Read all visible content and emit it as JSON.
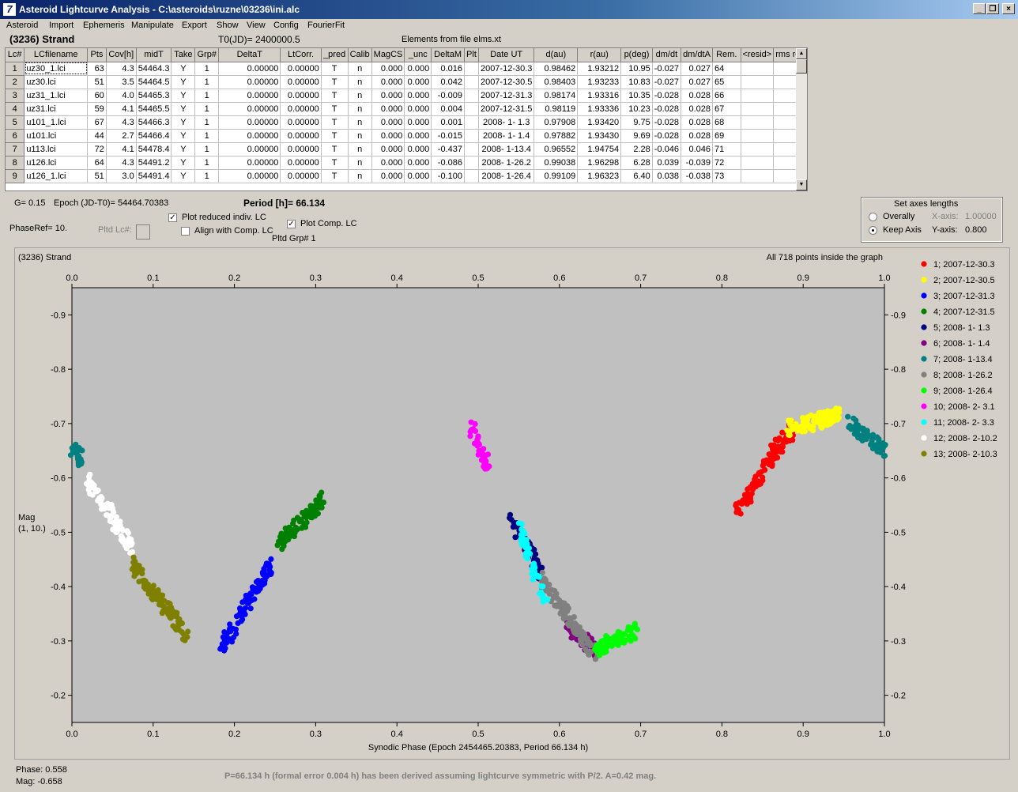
{
  "window": {
    "title": "Asteroid Lightcurve Analysis - C:\\asteroids\\ruzne\\03236\\ini.alc",
    "icon": "7"
  },
  "menu": [
    "Asteroid",
    "Import",
    "Ephemeris",
    "Manipulate",
    "Export",
    "Show",
    "View",
    "Config",
    "FourierFit"
  ],
  "header": {
    "asteroid": "(3236) Strand",
    "t0": "T0(JD)= 2400000.5",
    "elements": "Elements from file elms.xt"
  },
  "table": {
    "columns": [
      "Lc#",
      "LCfilename",
      "Pts",
      "Cov[h]",
      "midT",
      "Take",
      "Grp#",
      "DeltaT",
      "LtCorr.",
      "_pred",
      "Calib",
      "MagCS",
      "_unc",
      "DeltaM",
      "Plt",
      "Date UT",
      "d(au)",
      "r(au)",
      "p(deg)",
      "dm/dt",
      "dm/dtA",
      "Rem.",
      "<resid>",
      "rms res"
    ],
    "rows": [
      [
        "1",
        "uz30_1.lci",
        "63",
        "4.3",
        "54464.3",
        "Y",
        "1",
        "0.00000",
        "0.00000",
        "T",
        "n",
        "0.000",
        "0.000",
        "0.016",
        "",
        "2007-12-30.3",
        "0.98462",
        "1.93212",
        "10.95",
        "-0.027",
        "0.027",
        "64",
        "",
        ""
      ],
      [
        "2",
        "uz30.lci",
        "51",
        "3.5",
        "54464.5",
        "Y",
        "1",
        "0.00000",
        "0.00000",
        "T",
        "n",
        "0.000",
        "0.000",
        "0.042",
        "",
        "2007-12-30.5",
        "0.98403",
        "1.93233",
        "10.83",
        "-0.027",
        "0.027",
        "65",
        "",
        ""
      ],
      [
        "3",
        "uz31_1.lci",
        "60",
        "4.0",
        "54465.3",
        "Y",
        "1",
        "0.00000",
        "0.00000",
        "T",
        "n",
        "0.000",
        "0.000",
        "-0.009",
        "",
        "2007-12-31.3",
        "0.98174",
        "1.93316",
        "10.35",
        "-0.028",
        "0.028",
        "66",
        "",
        ""
      ],
      [
        "4",
        "uz31.lci",
        "59",
        "4.1",
        "54465.5",
        "Y",
        "1",
        "0.00000",
        "0.00000",
        "T",
        "n",
        "0.000",
        "0.000",
        "0.004",
        "",
        "2007-12-31.5",
        "0.98119",
        "1.93336",
        "10.23",
        "-0.028",
        "0.028",
        "67",
        "",
        ""
      ],
      [
        "5",
        "u101_1.lci",
        "67",
        "4.3",
        "54466.3",
        "Y",
        "1",
        "0.00000",
        "0.00000",
        "T",
        "n",
        "0.000",
        "0.000",
        "0.001",
        "",
        "2008- 1- 1.3",
        "0.97908",
        "1.93420",
        "9.75",
        "-0.028",
        "0.028",
        "68",
        "",
        ""
      ],
      [
        "6",
        "u101.lci",
        "44",
        "2.7",
        "54466.4",
        "Y",
        "1",
        "0.00000",
        "0.00000",
        "T",
        "n",
        "0.000",
        "0.000",
        "-0.015",
        "",
        "2008- 1- 1.4",
        "0.97882",
        "1.93430",
        "9.69",
        "-0.028",
        "0.028",
        "69",
        "",
        ""
      ],
      [
        "7",
        "u113.lci",
        "72",
        "4.1",
        "54478.4",
        "Y",
        "1",
        "0.00000",
        "0.00000",
        "T",
        "n",
        "0.000",
        "0.000",
        "-0.437",
        "",
        "2008- 1-13.4",
        "0.96552",
        "1.94754",
        "2.28",
        "-0.046",
        "0.046",
        "71",
        "",
        ""
      ],
      [
        "8",
        "u126.lci",
        "64",
        "4.3",
        "54491.2",
        "Y",
        "1",
        "0.00000",
        "0.00000",
        "T",
        "n",
        "0.000",
        "0.000",
        "-0.086",
        "",
        "2008- 1-26.2",
        "0.99038",
        "1.96298",
        "6.28",
        "0.039",
        "-0.039",
        "72",
        "",
        ""
      ],
      [
        "9",
        "u126_1.lci",
        "51",
        "3.0",
        "54491.4",
        "Y",
        "1",
        "0.00000",
        "0.00000",
        "T",
        "n",
        "0.000",
        "0.000",
        "-0.100",
        "",
        "2008- 1-26.4",
        "0.99109",
        "1.96323",
        "6.40",
        "0.038",
        "-0.038",
        "73",
        "",
        ""
      ]
    ]
  },
  "controls": {
    "g": "G= 0.15",
    "epoch": "Epoch (JD-T0)= 54464.70383",
    "period": "Period [h]= 66.134",
    "phase_ref": "PhaseRef= 10.",
    "pltd_lc": "Pltd Lc#:",
    "plot_reduced": "Plot reduced indiv. LC",
    "align_comp": "Align with Comp. LC",
    "plot_comp": "Plot Comp. LC",
    "pltd_grp": "Pltd Grp#  1",
    "set_axes": "Set axes lengths",
    "overally": "Overally",
    "keep_axis": "Keep Axis",
    "x_axis_label": "X-axis:",
    "x_axis_val": "1.00000",
    "y_axis_label": "Y-axis:",
    "y_axis_val": "0.800"
  },
  "chart_data": {
    "type": "scatter",
    "title": "(3236) Strand",
    "note": "All 718 points inside the graph",
    "xlabel": "Synodic Phase (Epoch 2454465.20383, Period 66.134 h)",
    "ylabel": "Mag",
    "ylabel2": "(1, 10.)",
    "xlim": [
      0,
      1.0
    ],
    "ylim": [
      -0.95,
      -0.15
    ],
    "x_ticks": [
      "0.0",
      "0.1",
      "0.2",
      "0.3",
      "0.4",
      "0.5",
      "0.6",
      "0.7",
      "0.8",
      "0.9",
      "1.0"
    ],
    "y_ticks": [
      "-0.9",
      "-0.8",
      "-0.7",
      "-0.6",
      "-0.5",
      "-0.4",
      "-0.3",
      "-0.2"
    ],
    "grid": false,
    "legend_position": "right",
    "series": [
      {
        "name": "1; 2007-12-30.3",
        "color": "#ff0000",
        "segments": [
          [
            0.818,
            -0.535,
            0.865,
            -0.65
          ],
          [
            0.86,
            -0.64,
            0.888,
            -0.69
          ]
        ]
      },
      {
        "name": "2; 2007-12-30.5",
        "color": "#ffff00",
        "segments": [
          [
            0.88,
            -0.69,
            0.945,
            -0.715
          ]
        ]
      },
      {
        "name": "3; 2007-12-31.3",
        "color": "#0000ff",
        "segments": [
          [
            0.185,
            -0.29,
            0.245,
            -0.44
          ]
        ]
      },
      {
        "name": "4; 2007-12-31.5",
        "color": "#008000",
        "segments": [
          [
            0.255,
            -0.48,
            0.31,
            -0.56
          ]
        ]
      },
      {
        "name": "5; 2008- 1- 1.3",
        "color": "#000080",
        "segments": [
          [
            0.54,
            -0.53,
            0.578,
            -0.42
          ]
        ]
      },
      {
        "name": "6; 2008- 1- 1.4",
        "color": "#800080",
        "segments": [
          [
            0.61,
            -0.33,
            0.645,
            -0.28
          ]
        ]
      },
      {
        "name": "7; 2008- 1-13.4",
        "color": "#008080",
        "segments": [
          [
            0.955,
            -0.705,
            1.0,
            -0.65
          ],
          [
            0.0,
            -0.655,
            0.012,
            -0.635
          ]
        ]
      },
      {
        "name": "8; 2008- 1-26.2",
        "color": "#808080",
        "segments": [
          [
            0.575,
            -0.42,
            0.645,
            -0.27
          ]
        ]
      },
      {
        "name": "9; 2008- 1-26.4",
        "color": "#00ff00",
        "segments": [
          [
            0.645,
            -0.285,
            0.695,
            -0.32
          ]
        ]
      },
      {
        "name": "10; 2008- 2- 3.1",
        "color": "#ff00ff",
        "segments": [
          [
            0.49,
            -0.7,
            0.512,
            -0.62
          ]
        ]
      },
      {
        "name": "11; 2008- 2- 3.3",
        "color": "#00ffff",
        "segments": [
          [
            0.55,
            -0.51,
            0.585,
            -0.36
          ]
        ]
      },
      {
        "name": "12; 2008- 2-10.2",
        "color": "#ffffff",
        "segments": [
          [
            0.018,
            -0.6,
            0.075,
            -0.47
          ]
        ]
      },
      {
        "name": "13; 2008- 2-10.3",
        "color": "#808000",
        "segments": [
          [
            0.075,
            -0.44,
            0.142,
            -0.31
          ]
        ]
      }
    ]
  },
  "status": {
    "phase": "Phase:  0.558",
    "mag": "Mag:    -0.658",
    "message": "P=66.134 h (formal error 0.004 h) has been derived assuming lightcurve symmetric with P/2. A=0.42 mag."
  }
}
